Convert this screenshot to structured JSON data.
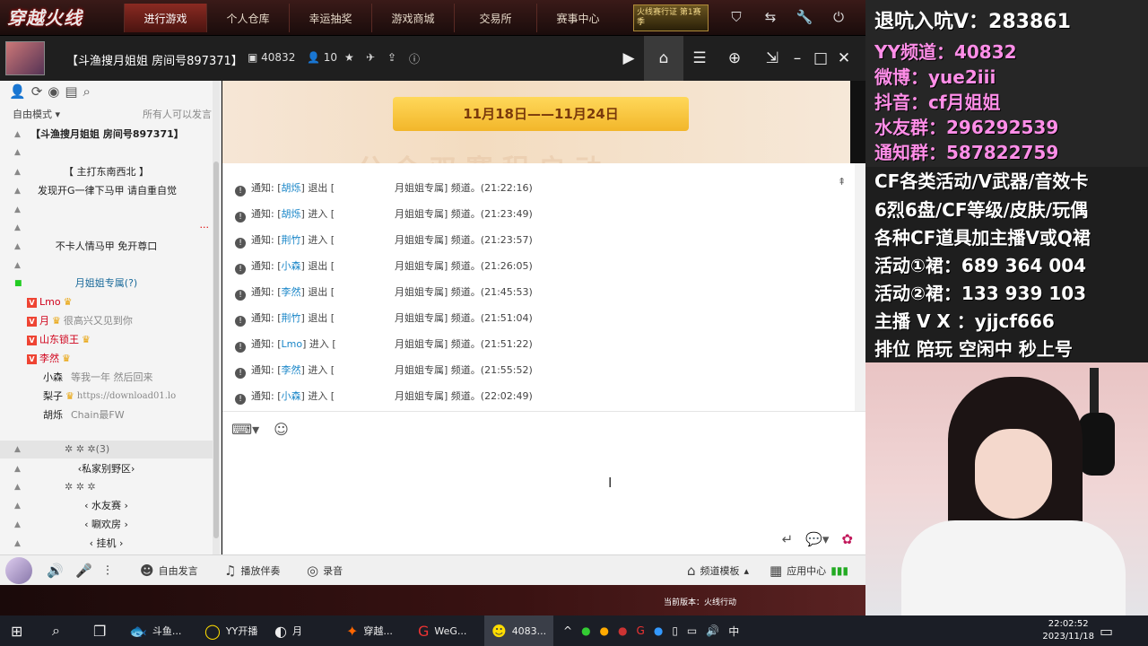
{
  "game": {
    "logo": "穿越火线",
    "tabs": [
      "进行游戏",
      "个人仓库",
      "幸运抽奖",
      "游戏商城",
      "交易所",
      "赛事中心"
    ],
    "badge": "火线赛行证 第1赛季"
  },
  "room": {
    "title": "【斗渔搜月姐姐 房间号897371】",
    "id": "40832",
    "online": "10"
  },
  "sidebar": {
    "mode": "自由模式",
    "all_can_speak": "所有人可以发言",
    "rows": [
      {
        "text": "【斗渔搜月姐姐 房间号897371】",
        "bold": true
      },
      {
        "text": ""
      },
      {
        "text": "【 主打东南西北 】"
      },
      {
        "text": "发现开G一律下马甲 请自重自觉"
      },
      {
        "text": ""
      },
      {
        "text": "···"
      },
      {
        "text": "不卡人情马甲 免开尊口"
      },
      {
        "text": ""
      },
      {
        "text": "月姐姐专属(?)"
      }
    ],
    "users": [
      {
        "name": "Lmo",
        "note": "",
        "color": "#d0021b"
      },
      {
        "name": "月",
        "note": "很高兴又见到你",
        "color": "#d0021b"
      },
      {
        "name": "山东锁王",
        "note": "",
        "color": "#d0021b"
      },
      {
        "name": "李然",
        "note": "",
        "color": "#d0021b"
      },
      {
        "name": "小森",
        "note": "等我一年 然后回来",
        "color": "#222"
      },
      {
        "name": "梨子",
        "note": "https://download01.lo",
        "color": "#222"
      },
      {
        "name": "胡烁",
        "note": "Chain最FW",
        "color": "#222"
      }
    ],
    "lower_rows": [
      {
        "text": "✲   ✲   ✲(3)"
      },
      {
        "text": "‹私家别野区›"
      },
      {
        "text": "✲   ✲   ✲"
      },
      {
        "text": "‹ 水友赛 ›"
      },
      {
        "text": "‹ 唰欢房 ›"
      },
      {
        "text": "‹ 挂机 ›"
      }
    ]
  },
  "banner": {
    "dates": "11月18日——11月24日",
    "subtitle": "公 会 双 赛 程 启 动"
  },
  "chat": {
    "messages": [
      {
        "name": "胡烁",
        "action": "退出",
        "time": "(21:22:16)"
      },
      {
        "name": "胡烁",
        "action": "进入",
        "time": "(21:23:49)"
      },
      {
        "name": "荆竹",
        "action": "进入",
        "time": "(21:23:57)"
      },
      {
        "name": "小森",
        "action": "退出",
        "time": "(21:26:05)"
      },
      {
        "name": "李然",
        "action": "退出",
        "time": "(21:45:53)"
      },
      {
        "name": "荆竹",
        "action": "退出",
        "time": "(21:51:04)"
      },
      {
        "name": "Lmo",
        "action": "进入",
        "time": "(21:51:22)"
      },
      {
        "name": "李然",
        "action": "进入",
        "time": "(21:55:52)"
      },
      {
        "name": "小森",
        "action": "进入",
        "time": "(22:02:49)"
      }
    ],
    "notice_label": "通知:",
    "channel_text": "月姐姐专属] 频道。"
  },
  "bottom": {
    "free_speak": "自由发言",
    "play_music": "播放伴奏",
    "record": "录音",
    "channel_template": "频道模板",
    "app_center": "应用中心"
  },
  "game_notice": "当前版本：火线行动",
  "taskbar": {
    "items": [
      "斗鱼...",
      "YY开播",
      "月",
      "穿越...",
      "WeG...",
      "4083..."
    ],
    "time": "22:02:52",
    "date": "2023/11/18",
    "ime": "中"
  },
  "stream": {
    "lines": [
      {
        "text": "退吭入吭V：283861",
        "color": "#ffffff"
      },
      {
        "text": "YY频道：40832",
        "color": "#ff8ee8"
      },
      {
        "text": "微博：yue2iii",
        "color": "#ff8ee8"
      },
      {
        "text": "抖音：cf月姐姐",
        "color": "#ff8ee8"
      },
      {
        "text": "水友群：296292539",
        "color": "#ff8ee8"
      },
      {
        "text": "通知群：587822759",
        "color": "#ff8ee8"
      },
      {
        "text": "CF各类活动/V武器/音效卡",
        "color": "#ffffff"
      },
      {
        "text": "6烈6盘/CF等级/皮肤/玩偶",
        "color": "#ffffff"
      },
      {
        "text": "各种CF道具加主播V或Q裙",
        "color": "#ffffff"
      },
      {
        "text": "活动①裙：689 364 004",
        "color": "#ffffff"
      },
      {
        "text": "活动②裙：133 939 103",
        "color": "#ffffff"
      },
      {
        "text": "主播 V X ：yjjcf666",
        "color": "#ffffff"
      },
      {
        "text": "排位 陪玩 空闲中 秒上号",
        "color": "#ffffff"
      }
    ]
  }
}
